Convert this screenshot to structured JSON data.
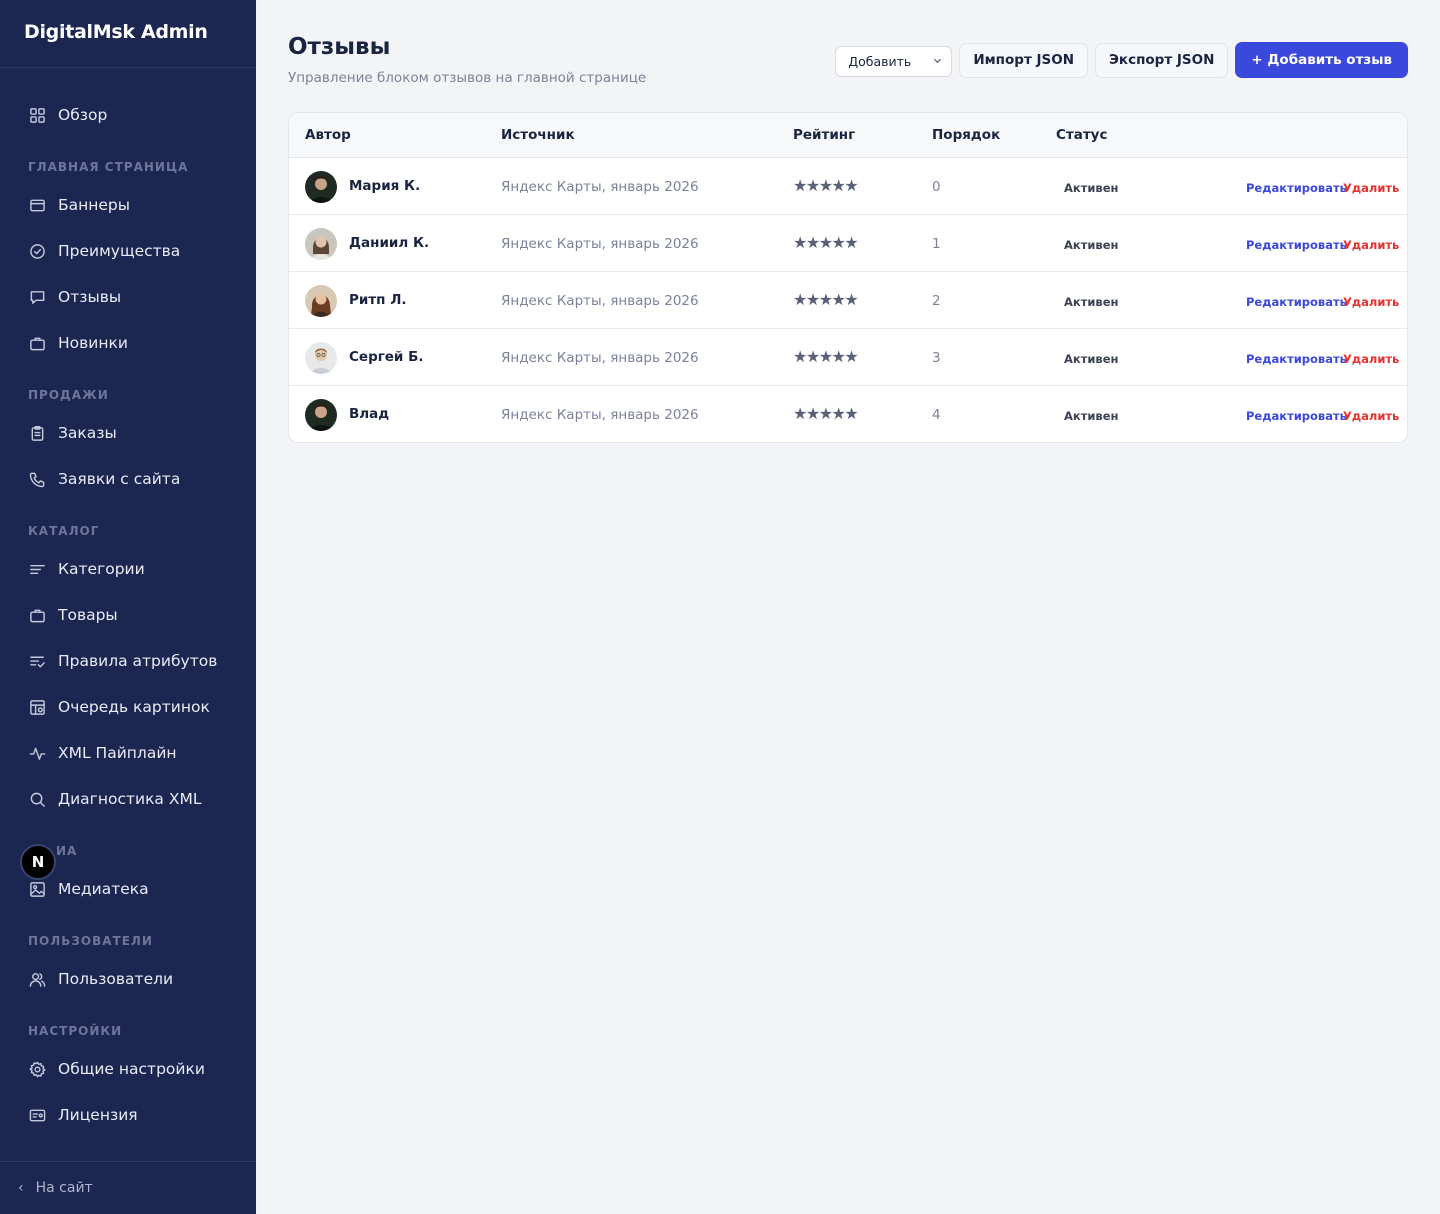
{
  "app": {
    "brand": "DigitalMsk Admin"
  },
  "sidebar": {
    "overview": "Обзор",
    "sections": {
      "home": "ГЛАВНАЯ СТРАНИЦА",
      "sales": "ПРОДАЖИ",
      "catalog": "КАТАЛОГ",
      "media": "ИА",
      "users": "ПОЛЬЗОВАТЕЛИ",
      "settings": "НАСТРОЙКИ"
    },
    "items": {
      "banners": "Баннеры",
      "advantages": "Преимущества",
      "reviews": "Отзывы",
      "novelties": "Новинки",
      "orders": "Заказы",
      "requests": "Заявки с сайта",
      "categories": "Категории",
      "products": "Товары",
      "attr_rules": "Правила атрибутов",
      "image_queue": "Очередь картинок",
      "xml_pipeline": "XML Пайплайн",
      "xml_diag": "Диагностика XML",
      "media_library": "Медиатека",
      "users": "Пользователи",
      "general_settings": "Общие настройки",
      "license": "Лицензия"
    },
    "footer": "На сайт",
    "badge": "N"
  },
  "header": {
    "title": "Отзывы",
    "subtitle": "Управление блоком отзывов на главной странице",
    "select_value": "Добавить",
    "import_label": "Импорт JSON",
    "export_label": "Экспорт JSON",
    "add_label": "+ Добавить отзыв"
  },
  "table": {
    "columns": {
      "author": "Автор",
      "source": "Источник",
      "rating": "Рейтинг",
      "order": "Порядок",
      "status": "Статус"
    },
    "edit_label": "Редактировать",
    "delete_label": "Удалить",
    "rows": [
      {
        "author": "Мария К.",
        "source": "Яндекс Карты, январь 2026",
        "rating": 5,
        "stars": "★★★★★",
        "order": "0",
        "status": "Активен"
      },
      {
        "author": "Даниил К.",
        "source": "Яндекс Карты, январь 2026",
        "rating": 5,
        "stars": "★★★★★",
        "order": "1",
        "status": "Активен"
      },
      {
        "author": "Ритп Л.",
        "source": "Яндекс Карты, январь 2026",
        "rating": 5,
        "stars": "★★★★★",
        "order": "2",
        "status": "Активен"
      },
      {
        "author": "Сергей Б.",
        "source": "Яндекс Карты, январь 2026",
        "rating": 5,
        "stars": "★★★★★",
        "order": "3",
        "status": "Активен"
      },
      {
        "author": "Влад",
        "source": "Яндекс Карты, январь 2026",
        "rating": 5,
        "stars": "★★★★★",
        "order": "4",
        "status": "Активен"
      }
    ]
  },
  "colors": {
    "sidebar": "#1c2751",
    "primary": "#3b48dc",
    "danger": "#e5322d",
    "background": "#f3f4f6"
  }
}
